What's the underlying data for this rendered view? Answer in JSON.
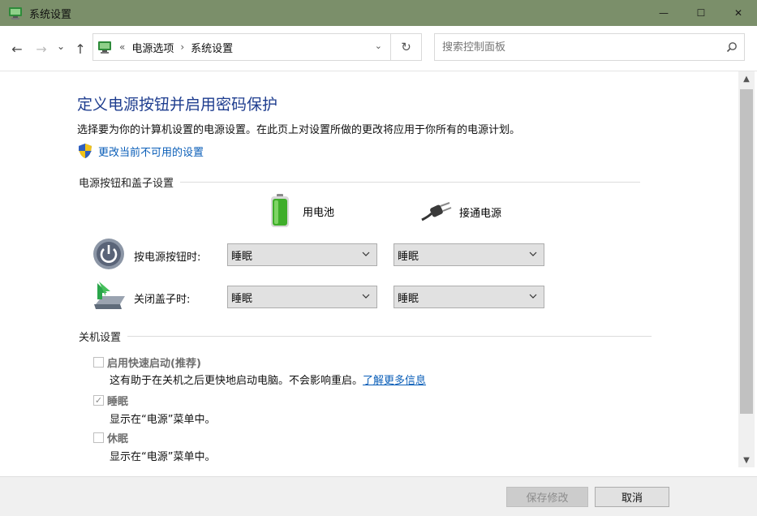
{
  "window": {
    "title": "系统设置",
    "minimize_glyph": "—",
    "maximize_glyph": "☐",
    "close_glyph": "✕"
  },
  "nav": {
    "back_glyph": "←",
    "forward_glyph": "→",
    "recent_glyph": "⌄",
    "up_glyph": "↑",
    "refresh_glyph": "↻"
  },
  "breadcrumb": {
    "overflow": "«",
    "separator": "›",
    "items": [
      "电源选项",
      "系统设置"
    ],
    "dropdown_glyph": "⌄"
  },
  "search": {
    "placeholder": "搜索控制面板",
    "value": ""
  },
  "page": {
    "title": "定义电源按钮并启用密码保护",
    "description": "选择要为你的计算机设置的电源设置。在此页上对设置所做的更改将应用于你所有的电源计划。",
    "change_link": "更改当前不可用的设置"
  },
  "power_section": {
    "heading": "电源按钮和盖子设置",
    "columns": [
      "用电池",
      "接通电源"
    ],
    "rows": [
      {
        "label": "按电源按钮时:",
        "battery": "睡眠",
        "plugged": "睡眠"
      },
      {
        "label": "关闭盖子时:",
        "battery": "睡眠",
        "plugged": "睡眠"
      }
    ]
  },
  "shutdown_section": {
    "heading": "关机设置",
    "items": [
      {
        "label": "启用快速启动(推荐)",
        "checked": false,
        "desc": "这有助于在关机之后更快地启动电脑。不会影响重启。",
        "link": "了解更多信息"
      },
      {
        "label": "睡眠",
        "checked": true,
        "desc": "显示在“电源”菜单中。"
      },
      {
        "label": "休眠",
        "checked": false,
        "desc": "显示在“电源”菜单中。"
      }
    ]
  },
  "buttons": {
    "save": "保存修改",
    "cancel": "取消"
  },
  "colors": {
    "titlebar": "#7b8f6a",
    "title_text": "#1e3d8f",
    "link": "#0a5eb8",
    "battery_green": "#3fae2a"
  },
  "icons": {
    "app": "control-panel-icon",
    "shield": "uac-shield-icon",
    "battery": "battery-icon",
    "plug": "power-plug-icon",
    "power_button": "power-button-icon",
    "lid": "laptop-lid-icon",
    "search": "search-icon"
  }
}
